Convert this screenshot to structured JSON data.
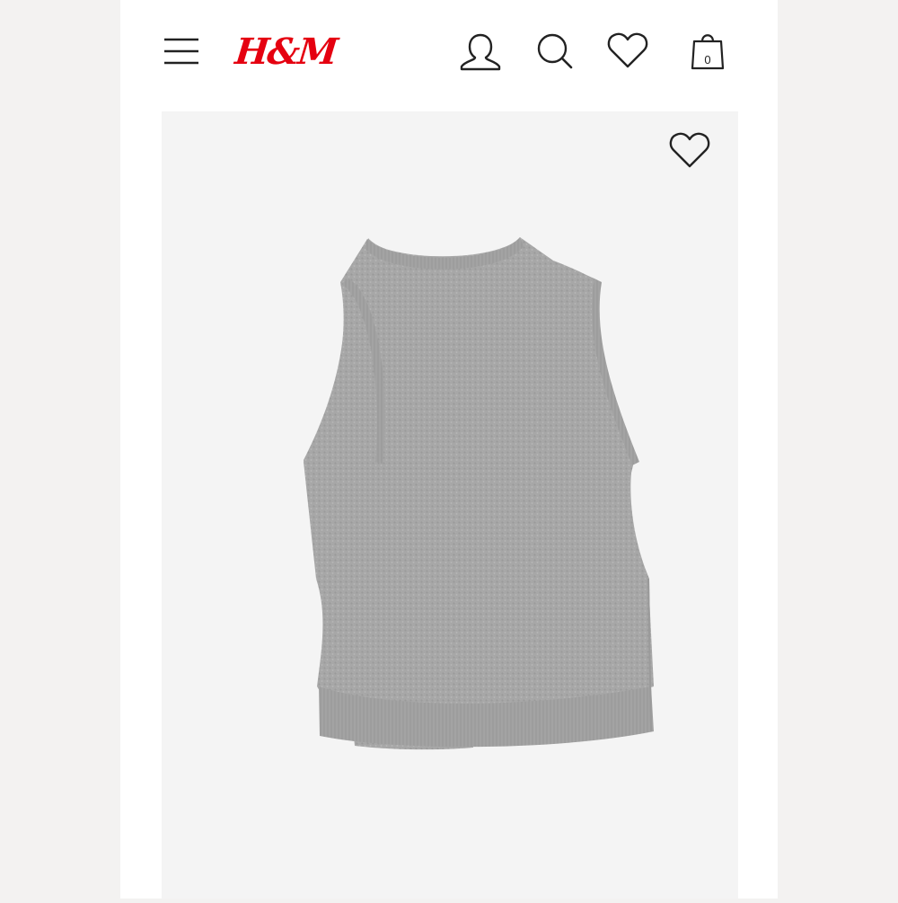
{
  "header": {
    "logo_text": "H&M",
    "bag_count": "0",
    "icons": {
      "menu": "hamburger-menu-icon",
      "account": "user-icon",
      "search": "search-icon",
      "favorites": "heart-icon",
      "bag": "shopping-bag-icon"
    }
  },
  "product": {
    "image": "grey-knit-sweater-vest",
    "favorite_icon": "heart-icon"
  },
  "colors": {
    "brand": "#e50010",
    "sweater": "#a6a6a6",
    "image_background": "#f4f4f4",
    "icon": "#222222"
  }
}
